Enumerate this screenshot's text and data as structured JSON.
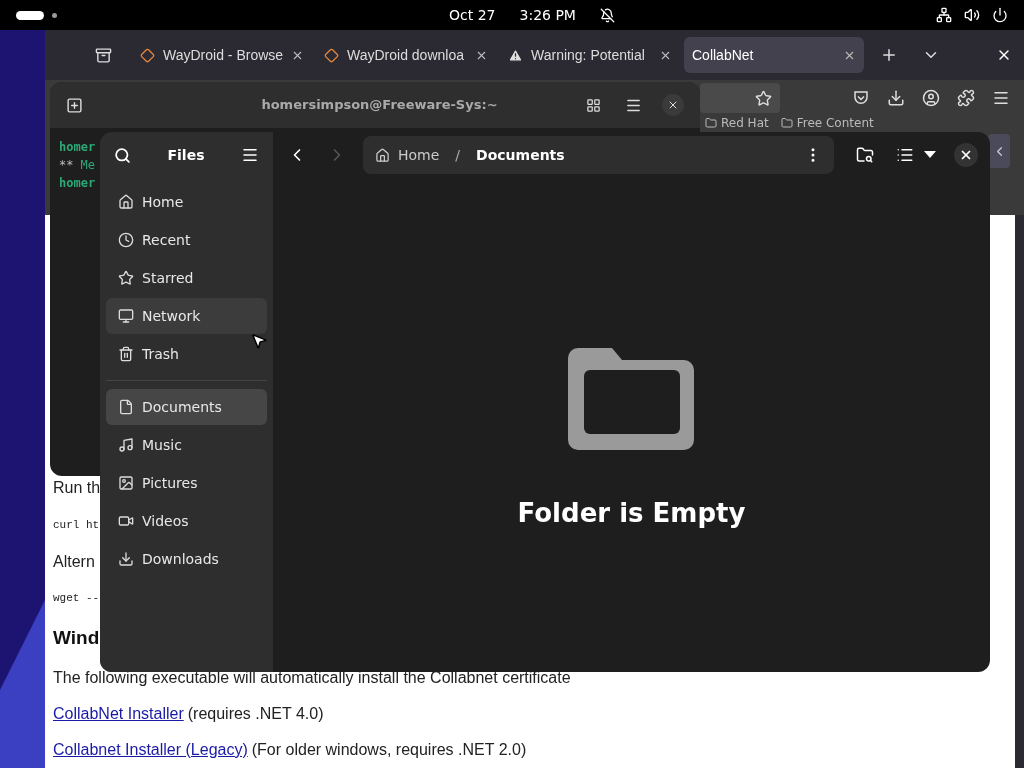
{
  "top_bar": {
    "date": "Oct 27",
    "time": "3:26 PM"
  },
  "browser": {
    "tabs": [
      {
        "title": "WayDroid - Browse",
        "kind": "site",
        "selected": false
      },
      {
        "title": "WayDroid downloa",
        "kind": "site",
        "selected": false
      },
      {
        "title": "Warning: Potential",
        "kind": "warning",
        "selected": false
      },
      {
        "title": "CollabNet",
        "kind": "plain",
        "selected": true
      }
    ],
    "bookmarks": [
      "Red Hat",
      "Free Content"
    ],
    "page": [
      {
        "kind": "text",
        "text": "Run th"
      },
      {
        "kind": "code",
        "text": "curl ht"
      },
      {
        "kind": "text",
        "text": "Altern"
      },
      {
        "kind": "code",
        "text": "wget --"
      },
      {
        "kind": "heading",
        "text": "Wind"
      },
      {
        "kind": "text",
        "text": "The following executable will automatically install the Collabnet certificate"
      },
      {
        "kind": "link",
        "link": "CollabNet Installer",
        "text": "(requires .NET 4.0)"
      },
      {
        "kind": "link",
        "link": "Collabnet Installer (Legacy)",
        "text": "(For older windows, requires .NET 2.0)"
      }
    ]
  },
  "terminal": {
    "title": "homersimpson@Freeware-Sys:~",
    "lines": [
      {
        "kind": "prompt",
        "text": "homer"
      },
      {
        "kind": "notice",
        "mark": "**",
        "text": "Me"
      },
      {
        "kind": "prompt",
        "text": "homer"
      }
    ]
  },
  "files": {
    "title": "Files",
    "places": [
      {
        "label": "Home",
        "selected": false,
        "hovered": false
      },
      {
        "label": "Recent",
        "selected": false,
        "hovered": false
      },
      {
        "label": "Starred",
        "selected": false,
        "hovered": false
      },
      {
        "label": "Network",
        "selected": false,
        "hovered": true
      },
      {
        "label": "Trash",
        "selected": false,
        "hovered": false
      }
    ],
    "bookmarks": [
      {
        "label": "Documents",
        "selected": true,
        "hovered": false
      },
      {
        "label": "Music",
        "selected": false,
        "hovered": false
      },
      {
        "label": "Pictures",
        "selected": false,
        "hovered": false
      },
      {
        "label": "Videos",
        "selected": false,
        "hovered": false
      },
      {
        "label": "Downloads",
        "selected": false,
        "hovered": false
      }
    ],
    "path": [
      "Home",
      "Documents"
    ],
    "separator": "/",
    "forward_disabled": true,
    "empty_message": "Folder is Empty"
  }
}
